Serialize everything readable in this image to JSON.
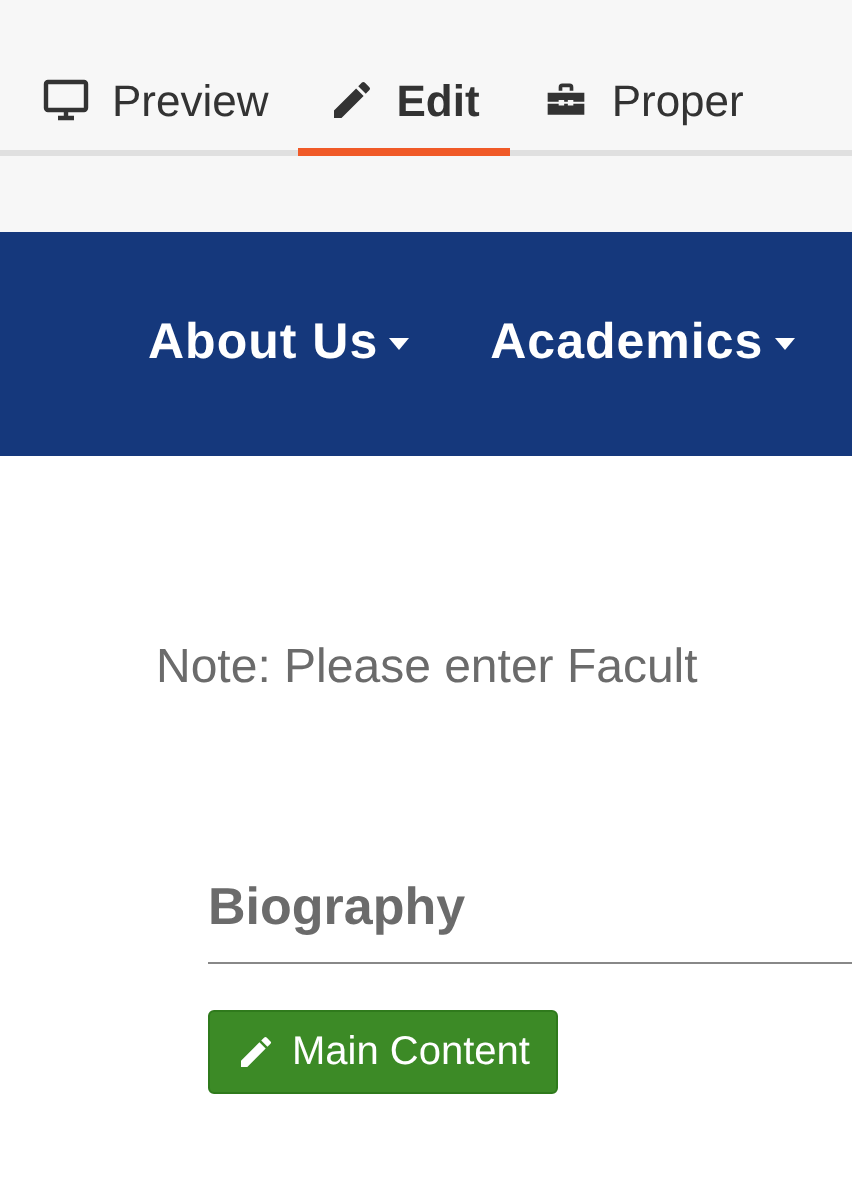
{
  "tabs": [
    {
      "label": "Preview",
      "kind": "preview",
      "selected": false
    },
    {
      "label": "Edit",
      "kind": "edit",
      "selected": true
    },
    {
      "label": "Proper",
      "kind": "properties",
      "selected": false
    }
  ],
  "nav": [
    {
      "label": "About Us"
    },
    {
      "label": "Academics"
    }
  ],
  "note": "Note: Please enter Facult",
  "section": {
    "heading": "Biography",
    "button": "Main Content"
  }
}
